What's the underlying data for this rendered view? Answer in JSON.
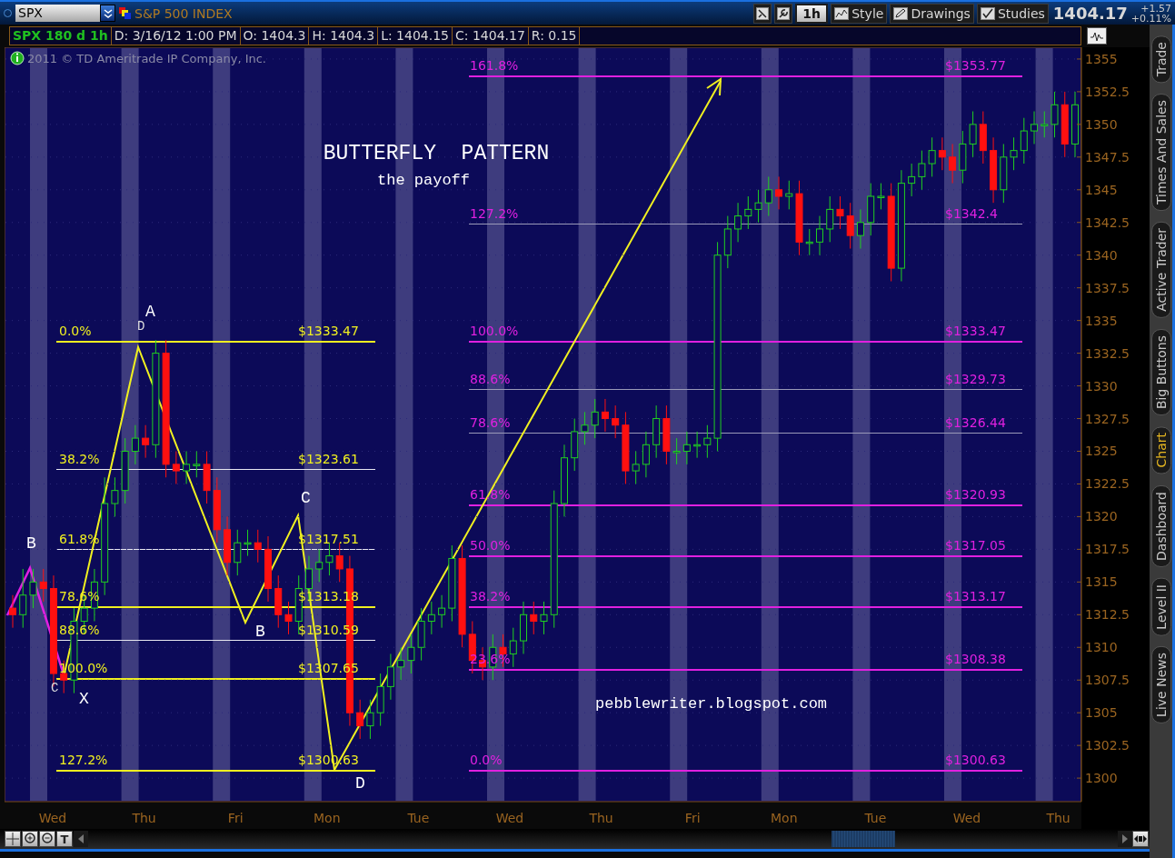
{
  "header": {
    "symbol": "SPX",
    "name": "S&P 500 INDEX",
    "buttons": [
      {
        "label": "1h",
        "kind": "period"
      },
      {
        "label": "Style",
        "kind": "menu"
      },
      {
        "label": "Drawings",
        "kind": "menu"
      },
      {
        "label": "Studies",
        "kind": "menu"
      }
    ],
    "last": "1404.17",
    "change": "+1.57",
    "change_pct": "+0.11%"
  },
  "info_bar": {
    "study": "SPX 180 d 1h",
    "fields": [
      "D: 3/16/12 1:00 PM",
      "O: 1404.3",
      "H: 1404.3",
      "L: 1404.15",
      "C: 1404.17",
      "R: 0.15"
    ]
  },
  "chart": {
    "copyright": "2011 © TD Ameritrade IP Company, Inc.",
    "title": "BUTTERFLY  PATTERN",
    "subtitle": "the payoff",
    "signature": "pebblewriter.blogspot.com",
    "fib_left": [
      {
        "pct": "0.0%",
        "price": "$1333.47",
        "color": "#f0f020"
      },
      {
        "pct": "38.2%",
        "price": "$1323.61",
        "color": "#e8e8f0"
      },
      {
        "pct": "61.8%",
        "price": "$1317.51",
        "color": "#e8e8f0"
      },
      {
        "pct": "78.6%",
        "price": "$1313.18",
        "color": "#f0f020"
      },
      {
        "pct": "88.6%",
        "price": "$1310.59",
        "color": "#e8e8f0"
      },
      {
        "pct": "100.0%",
        "price": "$1307.65",
        "color": "#f0f020"
      },
      {
        "pct": "127.2%",
        "price": "$1300.63",
        "color": "#f0f020"
      }
    ],
    "fib_right": [
      {
        "pct": "161.8%",
        "price": "$1353.77",
        "color": "#e020e0"
      },
      {
        "pct": "127.2%",
        "price": "$1342.4",
        "color": "#9a9ab8"
      },
      {
        "pct": "100.0%",
        "price": "$1333.47",
        "color": "#e020e0"
      },
      {
        "pct": "88.6%",
        "price": "$1329.73",
        "color": "#9a9ab8"
      },
      {
        "pct": "78.6%",
        "price": "$1326.44",
        "color": "#9a9ab8"
      },
      {
        "pct": "61.8%",
        "price": "$1320.93",
        "color": "#e020e0"
      },
      {
        "pct": "50.0%",
        "price": "$1317.05",
        "color": "#e020e0"
      },
      {
        "pct": "38.2%",
        "price": "$1313.17",
        "color": "#e020e0"
      },
      {
        "pct": "23.6%",
        "price": "$1308.38",
        "color": "#e020e0"
      },
      {
        "pct": "0.0%",
        "price": "$1300.63",
        "color": "#e020e0"
      }
    ],
    "x_labels": [
      "Wed",
      "Thu",
      "Fri",
      "Mon",
      "Tue",
      "Wed",
      "Thu",
      "Fri",
      "Mon",
      "Tue",
      "Wed",
      "Thu"
    ],
    "chart_data": {
      "type": "candlestick",
      "ylim": [
        1298.2,
        1355.9
      ],
      "grid": true,
      "yticks": [
        1355,
        1352.5,
        1350,
        1347.5,
        1345,
        1342.5,
        1340,
        1337.5,
        1335,
        1332.5,
        1330,
        1327.5,
        1325,
        1322.5,
        1320,
        1317.5,
        1315,
        1312.5,
        1310,
        1307.5,
        1305,
        1302.5,
        1300
      ],
      "ohlc": [
        [
          1313,
          1314,
          1311.5,
          1312.5
        ],
        [
          1312.5,
          1316,
          1311.5,
          1314
        ],
        [
          1314,
          1316,
          1313,
          1315
        ],
        [
          1315,
          1316,
          1313.5,
          1314.5
        ],
        [
          1314.5,
          1315.5,
          1307,
          1308
        ],
        [
          1308,
          1309,
          1306.5,
          1307.5
        ],
        [
          1307.5,
          1313,
          1306.5,
          1312
        ],
        [
          1312,
          1314,
          1311,
          1313
        ],
        [
          1313,
          1316,
          1312,
          1315
        ],
        [
          1315,
          1323,
          1314,
          1321
        ],
        [
          1321,
          1323,
          1320,
          1322
        ],
        [
          1322,
          1326,
          1321,
          1325
        ],
        [
          1325,
          1327,
          1324,
          1326
        ],
        [
          1326,
          1327,
          1324.5,
          1325.5
        ],
        [
          1325.5,
          1333.5,
          1324.5,
          1332.5
        ],
        [
          1332.5,
          1333.5,
          1323,
          1324
        ],
        [
          1324,
          1325,
          1322.5,
          1323.5
        ],
        [
          1323.5,
          1325,
          1322.5,
          1324
        ],
        [
          1324,
          1325,
          1323,
          1324
        ],
        [
          1324,
          1325,
          1321,
          1322
        ],
        [
          1322,
          1323,
          1318,
          1319
        ],
        [
          1319,
          1320,
          1315.5,
          1316.5
        ],
        [
          1316.5,
          1319,
          1315.5,
          1318
        ],
        [
          1318,
          1319,
          1317,
          1318
        ],
        [
          1318,
          1319,
          1316.5,
          1317.5
        ],
        [
          1317.5,
          1318.5,
          1313.5,
          1314.5
        ],
        [
          1314.5,
          1315.5,
          1311.5,
          1312.5
        ],
        [
          1312.5,
          1313.5,
          1311,
          1312
        ],
        [
          1312,
          1315.5,
          1311,
          1314.5
        ],
        [
          1314.5,
          1317,
          1313.5,
          1316
        ],
        [
          1316,
          1317.5,
          1315,
          1316.5
        ],
        [
          1316.5,
          1318,
          1315.5,
          1317
        ],
        [
          1317,
          1318,
          1315,
          1316
        ],
        [
          1316,
          1317,
          1304,
          1305
        ],
        [
          1305,
          1306,
          1303,
          1304
        ],
        [
          1304,
          1306,
          1303,
          1305
        ],
        [
          1305,
          1308,
          1304,
          1307
        ],
        [
          1307,
          1309.5,
          1306,
          1308.5
        ],
        [
          1308.5,
          1310,
          1307.5,
          1309
        ],
        [
          1309,
          1311,
          1308,
          1310
        ],
        [
          1310,
          1313,
          1309,
          1312
        ],
        [
          1312,
          1313.5,
          1311,
          1312.5
        ],
        [
          1312.5,
          1314,
          1311.5,
          1313
        ],
        [
          1313,
          1317.8,
          1312,
          1316.8
        ],
        [
          1316.8,
          1317.8,
          1310,
          1311
        ],
        [
          1311,
          1312,
          1308,
          1309
        ],
        [
          1309,
          1310,
          1307.5,
          1308.5
        ],
        [
          1308.5,
          1311,
          1307.5,
          1310
        ],
        [
          1310,
          1311,
          1308.5,
          1309.5
        ],
        [
          1309.5,
          1311.5,
          1308.5,
          1310.5
        ],
        [
          1310.5,
          1313.5,
          1309.5,
          1312.5
        ],
        [
          1312.5,
          1313.5,
          1311,
          1312
        ],
        [
          1312,
          1313.5,
          1311,
          1312.5
        ],
        [
          1312.5,
          1322,
          1311.5,
          1321
        ],
        [
          1321,
          1325.5,
          1320,
          1324.5
        ],
        [
          1324.5,
          1327.5,
          1323.5,
          1326.5
        ],
        [
          1326.5,
          1328,
          1325.5,
          1327
        ],
        [
          1327,
          1329,
          1326,
          1328
        ],
        [
          1328,
          1329,
          1326.5,
          1327.5
        ],
        [
          1327.5,
          1328.5,
          1326,
          1327
        ],
        [
          1327,
          1328,
          1322.5,
          1323.5
        ],
        [
          1323.5,
          1325,
          1322.5,
          1324
        ],
        [
          1324,
          1326.5,
          1323,
          1325.5
        ],
        [
          1325.5,
          1328.5,
          1324.5,
          1327.5
        ],
        [
          1327.5,
          1328.5,
          1324,
          1325
        ],
        [
          1325,
          1326,
          1324,
          1325
        ],
        [
          1325,
          1326.5,
          1324,
          1325.5
        ],
        [
          1325.5,
          1326.5,
          1324.5,
          1325.5
        ],
        [
          1325.5,
          1327,
          1324.5,
          1326
        ],
        [
          1326,
          1341,
          1325,
          1340
        ],
        [
          1340,
          1343,
          1339,
          1342
        ],
        [
          1342,
          1344,
          1341,
          1343
        ],
        [
          1343,
          1344.5,
          1342,
          1343.5
        ],
        [
          1343.5,
          1345,
          1342.5,
          1344
        ],
        [
          1344,
          1346,
          1343,
          1345
        ],
        [
          1345,
          1346,
          1343.5,
          1344.5
        ],
        [
          1344.5,
          1345.7,
          1343.5,
          1344.7
        ],
        [
          1344.7,
          1345.7,
          1340,
          1341
        ],
        [
          1341,
          1342,
          1340,
          1341
        ],
        [
          1341,
          1343,
          1340,
          1342
        ],
        [
          1342,
          1344.5,
          1341,
          1343.5
        ],
        [
          1343.5,
          1344.5,
          1342,
          1343
        ],
        [
          1343,
          1344,
          1340.5,
          1341.5
        ],
        [
          1341.5,
          1343.5,
          1340.5,
          1342.5
        ],
        [
          1342.5,
          1345.5,
          1341.5,
          1344.5
        ],
        [
          1344.5,
          1345.5,
          1343.5,
          1344.5
        ],
        [
          1344.5,
          1345.5,
          1338,
          1339
        ],
        [
          1339,
          1346.5,
          1338,
          1345.5
        ],
        [
          1345.5,
          1347,
          1344.5,
          1346
        ],
        [
          1346,
          1348,
          1345,
          1347
        ],
        [
          1347,
          1349,
          1346,
          1348
        ],
        [
          1348,
          1349,
          1346.5,
          1347.5
        ],
        [
          1347.5,
          1348.5,
          1345.5,
          1346.5
        ],
        [
          1346.5,
          1349.5,
          1345.5,
          1348.5
        ],
        [
          1348.5,
          1351,
          1347.5,
          1350
        ],
        [
          1350,
          1351,
          1347,
          1348
        ],
        [
          1348,
          1349,
          1344,
          1345
        ],
        [
          1345,
          1348.5,
          1344,
          1347.5
        ],
        [
          1347.5,
          1349,
          1346.5,
          1348
        ],
        [
          1348,
          1350.5,
          1347,
          1349.5
        ],
        [
          1349.5,
          1351,
          1348.5,
          1350
        ],
        [
          1350,
          1351,
          1349,
          1350
        ],
        [
          1350,
          1352.5,
          1349,
          1351.5
        ],
        [
          1351.5,
          1352.5,
          1347.5,
          1348.5
        ],
        [
          1348.5,
          1352.5,
          1347.5,
          1351.5
        ]
      ]
    },
    "pattern_labels": [
      {
        "text": "B",
        "kind": "major"
      },
      {
        "text": "A",
        "kind": "major"
      },
      {
        "text": "D",
        "kind": "minor"
      },
      {
        "text": "B",
        "kind": "major"
      },
      {
        "text": "C",
        "kind": "major"
      },
      {
        "text": "X",
        "kind": "major"
      },
      {
        "text": "C",
        "kind": "minor"
      },
      {
        "text": "D",
        "kind": "major"
      }
    ]
  },
  "bottom_toolbar": {
    "text_tool": "T"
  },
  "side_tabs": [
    {
      "label": "Trade",
      "selected": false
    },
    {
      "label": "Times And Sales",
      "selected": false
    },
    {
      "label": "Active Trader",
      "selected": false
    },
    {
      "label": "Big Buttons",
      "selected": false
    },
    {
      "label": "Chart",
      "selected": true
    },
    {
      "label": "Dashboard",
      "selected": false
    },
    {
      "label": "Level II",
      "selected": false
    },
    {
      "label": "Live News",
      "selected": false
    }
  ]
}
